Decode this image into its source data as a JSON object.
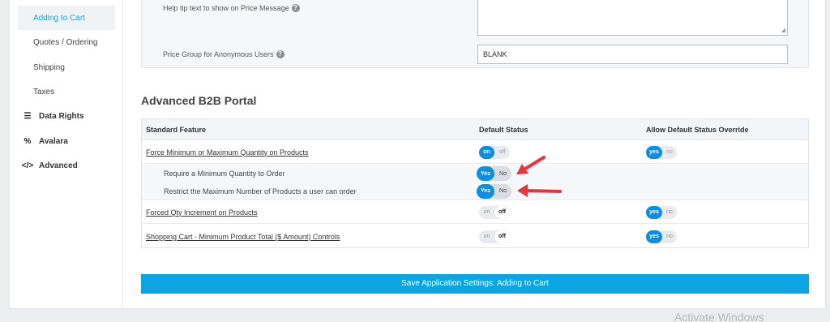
{
  "sidebar": {
    "items": [
      {
        "label": "Adding to Cart",
        "active": true,
        "icon": null
      },
      {
        "label": "Quotes / Ordering",
        "active": false,
        "icon": null
      },
      {
        "label": "Shipping",
        "active": false,
        "icon": null
      },
      {
        "label": "Taxes",
        "active": false,
        "icon": null
      },
      {
        "label": "Data Rights",
        "active": false,
        "icon": "database-icon",
        "glyph": "☰"
      },
      {
        "label": "Avalara",
        "active": false,
        "icon": "percent-icon",
        "glyph": "%"
      },
      {
        "label": "Advanced",
        "active": false,
        "icon": "code-icon",
        "glyph": "</>"
      }
    ]
  },
  "settings": {
    "help_tip_label": "Help tip text to show on Price Message",
    "price_group_label": "Price Group for Anonymous Users",
    "price_group_value": "BLANK"
  },
  "section": {
    "title": "Advanced B2B Portal"
  },
  "table": {
    "headers": {
      "feature": "Standard Feature",
      "default": "Default Status",
      "override": "Allow Default Status Override"
    },
    "rows": [
      {
        "feature": "Force Minimum or Maximum Quantity on Products",
        "default_on": "on",
        "default_off": "off",
        "default_state": "on",
        "override_yes": "yes",
        "override_no": "no",
        "override_state": "yes"
      },
      {
        "feature": "Require a Minimum Quantity to Order",
        "default_yes": "Yes",
        "default_no": "No",
        "default_state": "Yes"
      },
      {
        "feature": "Restrict the Maximum Number of Products a user can order",
        "default_yes": "Yes",
        "default_no": "No",
        "default_state": "Yes"
      },
      {
        "feature": "Forced Qty Increment on Products",
        "default_on": "on",
        "default_off": "off",
        "default_state": "off",
        "override_yes": "yes",
        "override_no": "no",
        "override_state": "yes"
      },
      {
        "feature": "Shopping Cart - Minimum Product Total ($ Amount) Controls",
        "default_on": "on",
        "default_off": "off",
        "default_state": "off",
        "override_yes": "yes",
        "override_no": "no",
        "override_state": "yes"
      }
    ]
  },
  "save_button": "Save Application Settings: Adding to Cart",
  "watermark": "Activate Windows",
  "colors": {
    "accent": "#1aa3e6",
    "toggle_on": "#0b8ee6",
    "save_bg": "#0ba5e4",
    "arrow": "#e8343f"
  }
}
